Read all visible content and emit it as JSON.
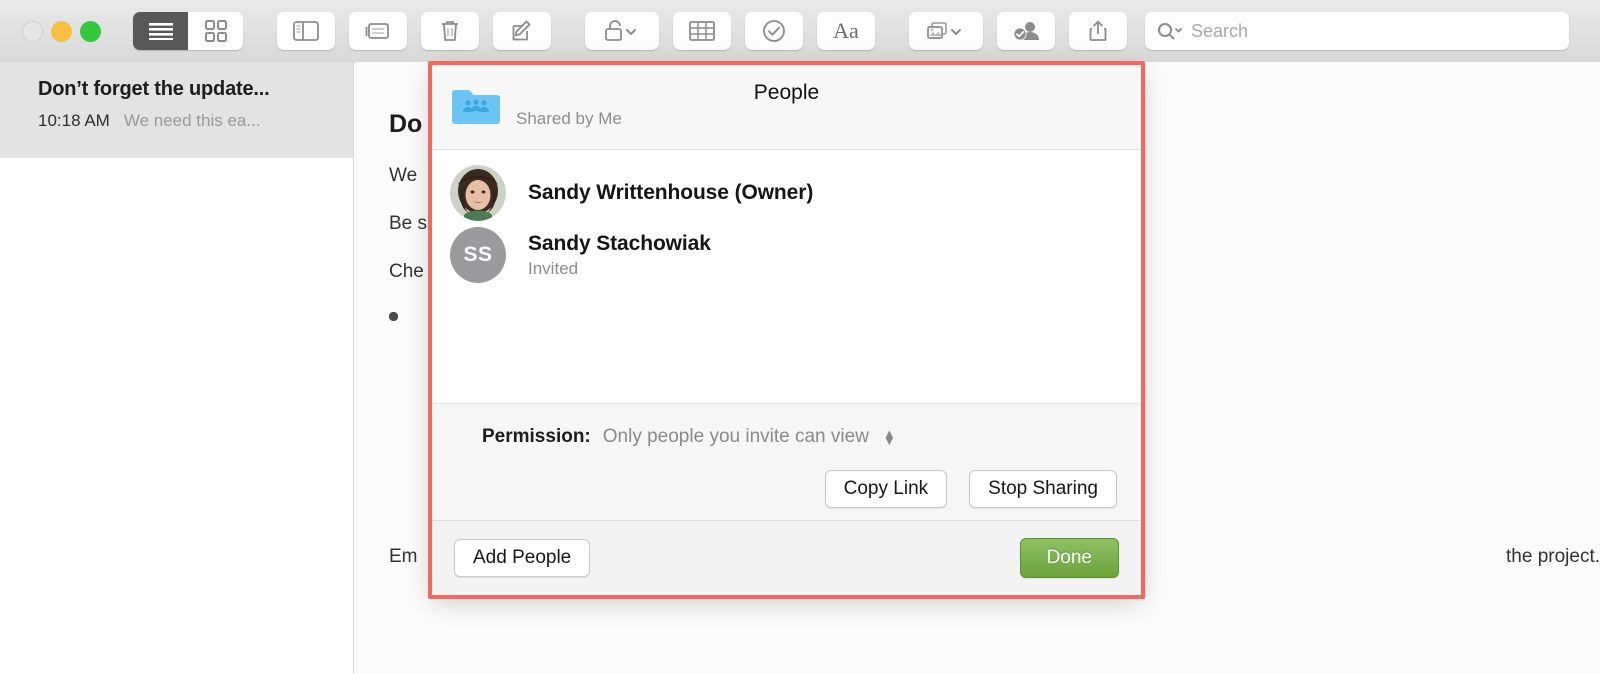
{
  "toolbar": {
    "traffic": {
      "close": "close",
      "minimize": "minimize",
      "maximize": "maximize"
    },
    "view_list": "List View",
    "view_grid": "Grid View",
    "sidebar_toggle": "Toggle Sidebar",
    "folders": "Folders",
    "delete": "Delete",
    "compose": "New Note",
    "lock": "Lock Note",
    "table": "Table",
    "checklist": "Checklist",
    "format": "Aa",
    "media": "Media",
    "share_people": "Share",
    "share_export": "Share Sheet",
    "search_placeholder": "Search"
  },
  "sidebar": {
    "note": {
      "title": "Don’t forget the update...",
      "time": "10:18 AM",
      "preview": "We need this ea..."
    }
  },
  "note_body": {
    "heading": "Do",
    "lines": [
      "We",
      "Be s",
      "Che"
    ],
    "bullets": [
      "",
      "",
      "",
      "",
      ""
    ],
    "last_left": "Em",
    "last_right": "the project."
  },
  "dialog": {
    "title": "People",
    "folder_icon": "shared-folder-icon",
    "shared_by": "Shared by Me",
    "people": [
      {
        "name": "Sandy Writtenhouse (Owner)",
        "status": "",
        "avatar_type": "photo",
        "initials": ""
      },
      {
        "name": "Sandy Stachowiak",
        "status": "Invited",
        "avatar_type": "initials",
        "initials": "SS"
      }
    ],
    "permission_label": "Permission:",
    "permission_value": "Only people you invite can view",
    "copy_link": "Copy Link",
    "stop_sharing": "Stop Sharing",
    "add_people": "Add People",
    "done": "Done"
  },
  "colors": {
    "highlight": "#f4685c",
    "primary_button": "#6ca33c",
    "folder_blue": "#6cc4f5",
    "avatar_gray": "#9a9a9f"
  }
}
